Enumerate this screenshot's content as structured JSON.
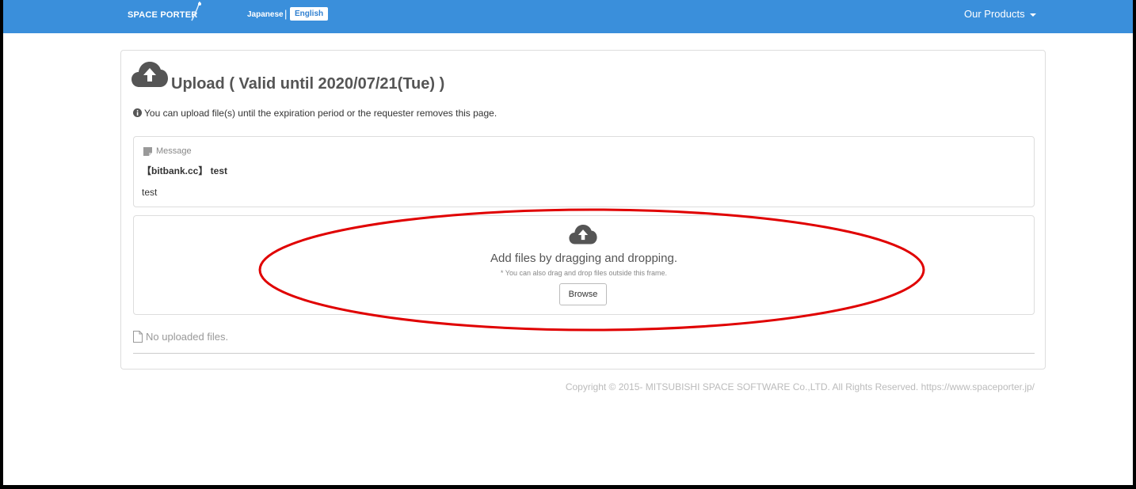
{
  "nav": {
    "brand": "SPACE PORTER",
    "lang_japanese": "Japanese",
    "lang_separator": "|",
    "lang_english": "English",
    "products": "Our Products"
  },
  "upload": {
    "title": "Upload ( Valid until 2020/07/21(Tue) )",
    "info": "You can upload file(s) until the expiration period or the requester removes this page."
  },
  "message": {
    "label": "Message",
    "subject": "【bitbank.cc】 test",
    "body": "test"
  },
  "dropzone": {
    "title": "Add files by dragging and dropping.",
    "note": "* You can also drag and drop files outside this frame.",
    "browse_label": "Browse"
  },
  "files": {
    "empty_text": "No uploaded files."
  },
  "footer": {
    "copyright": "Copyright © 2015- MITSUBISHI SPACE SOFTWARE Co.,LTD. All Rights Reserved. https://www.spaceporter.jp/"
  },
  "icons": {
    "upload": "cloud-upload-icon",
    "info": "info-circle-icon",
    "message": "sticky-note-icon",
    "file": "file-icon"
  },
  "colors": {
    "navbar": "#3a8fdb",
    "annotation": "#e00000"
  }
}
